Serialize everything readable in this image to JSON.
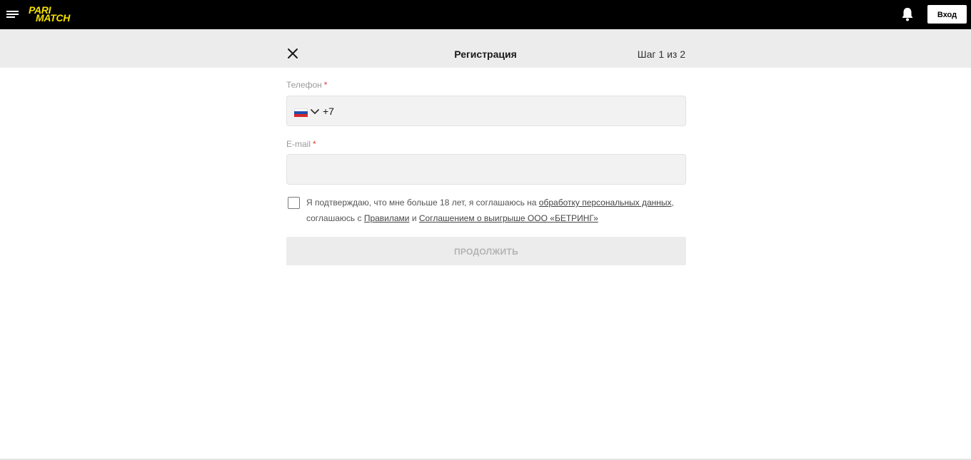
{
  "topbar": {
    "menu_icon": "hamburger-menu-icon",
    "logo_line1": "PARI",
    "logo_line2": "MATCH",
    "bell_icon": "bell-icon",
    "login_label": "Вход",
    "brand_color": "#f5e100"
  },
  "registration": {
    "close_icon": "close-icon",
    "title": "Регистрация",
    "step": "Шаг 1 из 2"
  },
  "form": {
    "phone": {
      "label": "Телефон",
      "required_mark": "*",
      "country_flag_icon": "russia-flag-icon",
      "dropdown_icon": "chevron-down-icon",
      "value": "+7"
    },
    "email": {
      "label": "E-mail",
      "required_mark": "*",
      "value": "",
      "placeholder": ""
    },
    "consent": {
      "checked": false,
      "text_part1": "Я подтверждаю, что мне больше 18 лет, я соглашаюсь на ",
      "link_personal_data": "обработку персональных данных",
      "text_part2": ", соглашаюсь с ",
      "link_rules": "Правилами",
      "text_part3": " и ",
      "link_agreement": "Соглашением о выигрыше ООО «БЕТРИНГ»"
    },
    "continue_label": "ПРОДОЛЖИТЬ"
  }
}
